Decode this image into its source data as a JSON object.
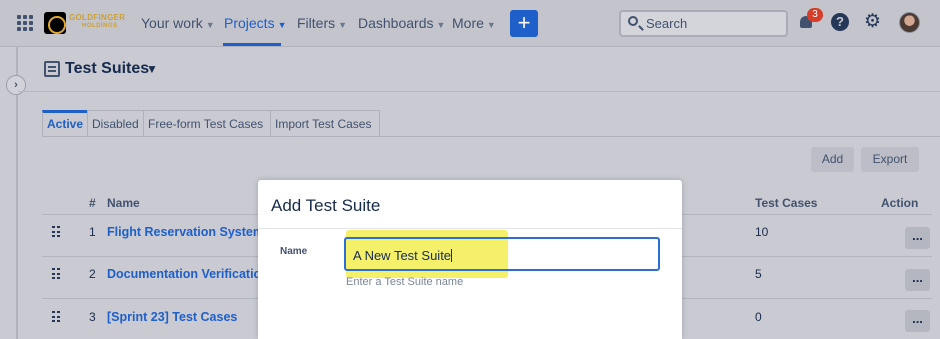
{
  "nav": {
    "logo_text": "GOLDFINGER",
    "logo_sub": "HOLDINGS",
    "items": [
      {
        "label": "Your work"
      },
      {
        "label": "Projects"
      },
      {
        "label": "Filters"
      },
      {
        "label": "Dashboards"
      },
      {
        "label": "More"
      }
    ],
    "create_label": "+",
    "search_placeholder": "Search",
    "notification_count": "3",
    "help_label": "?"
  },
  "page": {
    "title": "Test Suites"
  },
  "tabs": [
    {
      "label": "Active",
      "active": true
    },
    {
      "label": "Disabled"
    },
    {
      "label": "Free-form Test Cases"
    },
    {
      "label": "Import Test Cases"
    }
  ],
  "toolbar": {
    "add_label": "Add",
    "export_label": "Export"
  },
  "table": {
    "headers": {
      "num": "#",
      "name": "Name",
      "test_cases": "Test Cases",
      "action": "Action"
    },
    "rows": [
      {
        "num": "1",
        "name": "Flight Reservation System",
        "test_cases": "10",
        "action": "..."
      },
      {
        "num": "2",
        "name": "Documentation Verification",
        "test_cases": "5",
        "action": "..."
      },
      {
        "num": "3",
        "name": "[Sprint 23] Test Cases",
        "test_cases": "0",
        "action": "..."
      }
    ]
  },
  "modal": {
    "title": "Add Test Suite",
    "field_label": "Name",
    "field_value": "A New Test Suite",
    "field_help": "Enter a Test Suite name"
  },
  "colors": {
    "accent": "#1f5fc9",
    "highlight": "#f5f06a",
    "badge": "#d63e2a"
  }
}
